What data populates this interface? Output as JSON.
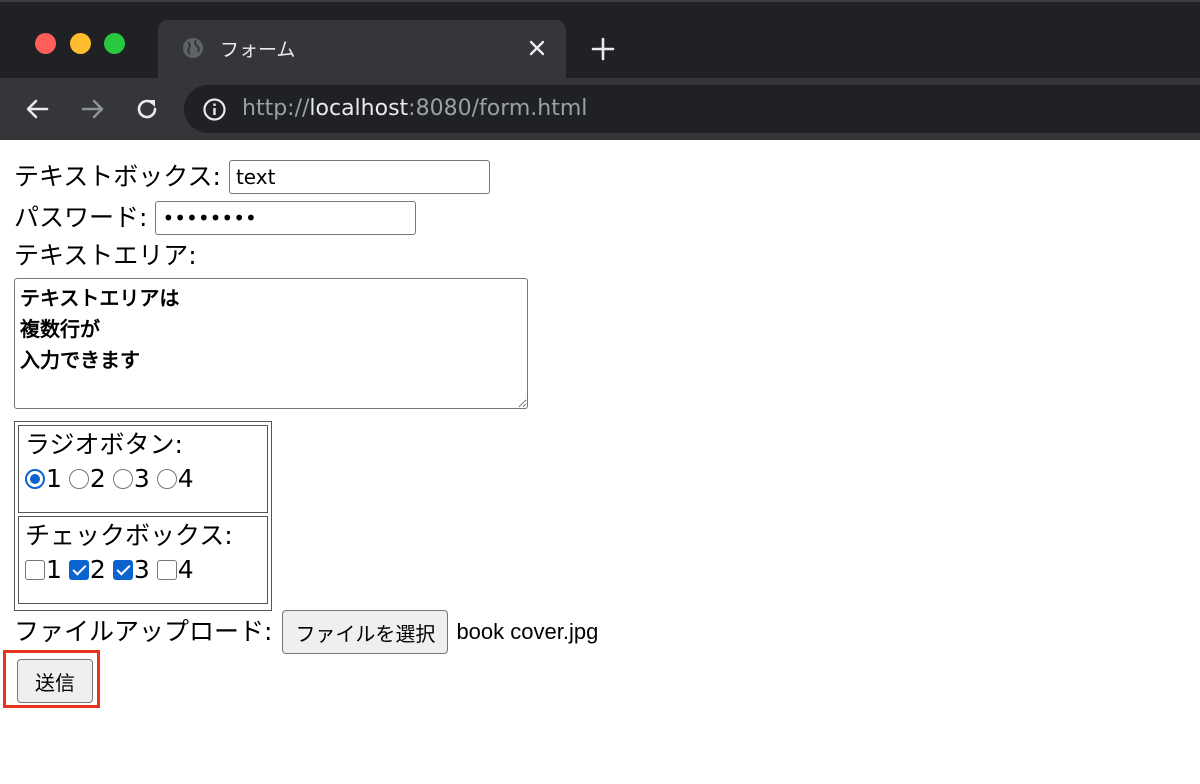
{
  "browser": {
    "tab_title": "フォーム",
    "url_scheme": "http://",
    "url_host": "localhost",
    "url_rest": ":8080/form.html"
  },
  "form": {
    "textbox_label": "テキストボックス:",
    "textbox_value": "text",
    "password_label": "パスワード:",
    "password_value": "••••••••",
    "textarea_label": "テキストエリア:",
    "textarea_value": "テキストエリアは\n複数行が\n入力できます",
    "radio_label": "ラジオボタン:",
    "radio_options": [
      "1",
      "2",
      "3",
      "4"
    ],
    "radio_selected": "1",
    "checkbox_label": "チェックボックス:",
    "checkbox_options": [
      "1",
      "2",
      "3",
      "4"
    ],
    "checkbox_checked": [
      "2",
      "3"
    ],
    "file_label": "ファイルアップロード:",
    "file_button": "ファイルを選択",
    "file_name": "book cover.jpg",
    "submit_label": "送信"
  },
  "colors": {
    "chrome_dark": "#202124",
    "chrome_tab": "#35363a",
    "accent_blue": "#0b63ce",
    "highlight_red": "#e8341c"
  }
}
